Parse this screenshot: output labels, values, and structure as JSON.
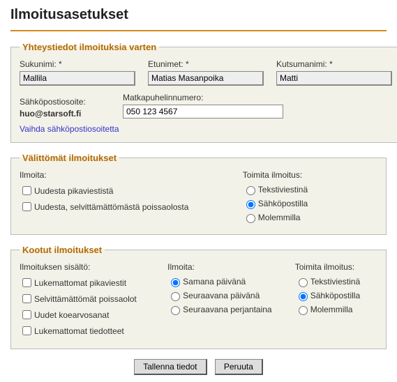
{
  "page": {
    "title": "Ilmoitusasetukset"
  },
  "contact": {
    "legend": "Yhteystiedot ilmoituksia varten",
    "lastnameLabel": "Sukunimi: *",
    "lastname": "Mallila",
    "firstnameLabel": "Etunimet: *",
    "firstname": "Matias Masanpoika",
    "nicknameLabel": "Kutsumanimi: *",
    "nickname": "Matti",
    "emailLabel": "Sähköpostiosoite:",
    "email": "huo@starsoft.fi",
    "phoneLabel": "Matkapuhelinnumero:",
    "phone": "050 123 4567",
    "changeEmailLink": "Vaihda sähköpostiosoitetta"
  },
  "instant": {
    "legend": "Välittömät ilmoitukset",
    "notifyHeader": "Ilmoita:",
    "deliverHeader": "Toimita ilmoitus:",
    "notify": [
      {
        "id": "uusiPikaviesti",
        "label": "Uudesta pikaviestistä",
        "checked": false
      },
      {
        "id": "uusiPoissaolo",
        "label": "Uudesta, selvittämättömästä poissaolosta",
        "checked": false
      }
    ],
    "delivery": [
      {
        "id": "instTxt",
        "label": "Tekstiviestinä",
        "checked": false
      },
      {
        "id": "instEmail",
        "label": "Sähköpostilla",
        "checked": true
      },
      {
        "id": "instBoth",
        "label": "Molemmilla",
        "checked": false
      }
    ]
  },
  "aggregate": {
    "legend": "Kootut ilmoitukset",
    "contentHeader": "Ilmoituksen sisältö:",
    "notifyHeader": "Ilmoita:",
    "deliverHeader": "Toimita ilmoitus:",
    "content": [
      {
        "id": "lukPika",
        "label": "Lukemattomat pikaviestit",
        "checked": false
      },
      {
        "id": "selPoissa",
        "label": "Selvittämättömät poissaolot",
        "checked": false
      },
      {
        "id": "uudetKoe",
        "label": "Uudet koearvosanat",
        "checked": false
      },
      {
        "id": "lukTied",
        "label": "Lukemattomat tiedotteet",
        "checked": false
      }
    ],
    "when": [
      {
        "id": "samana",
        "label": "Samana päivänä",
        "checked": true
      },
      {
        "id": "seuraava",
        "label": "Seuraavana päivänä",
        "checked": false
      },
      {
        "id": "perjantai",
        "label": "Seuraavana perjantaina",
        "checked": false
      }
    ],
    "delivery": [
      {
        "id": "aggTxt",
        "label": "Tekstiviestinä",
        "checked": false
      },
      {
        "id": "aggEmail",
        "label": "Sähköpostilla",
        "checked": true
      },
      {
        "id": "aggBoth",
        "label": "Molemmilla",
        "checked": false
      }
    ]
  },
  "buttons": {
    "save": "Tallenna tiedot",
    "cancel": "Peruuta"
  }
}
